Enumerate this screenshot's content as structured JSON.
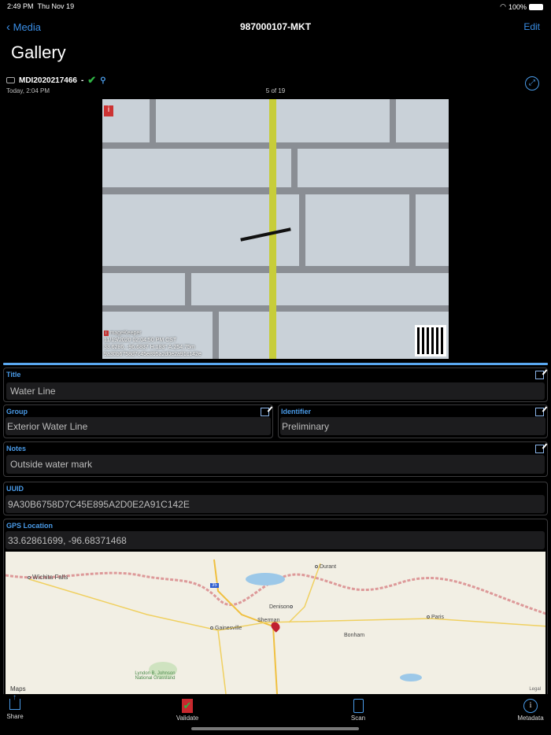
{
  "status": {
    "time": "2:49 PM",
    "date": "Thu Nov 19",
    "battery": "100%"
  },
  "nav": {
    "back": "Media",
    "title": "987000107-MKT",
    "edit": "Edit"
  },
  "page_title": "Gallery",
  "media": {
    "id": "MDI2020217466",
    "sep": "-",
    "timestamp": "Today, 2:04 PM",
    "counter": "5 of 19"
  },
  "photo": {
    "watermark_brand": "ImageKeeper",
    "overlay_lines": [
      "11/19/2020 02:04:50 PM CST",
      "33.6286, -96.6837 H:183° A:254.75m",
      "9a30b6758d7c45e895a2d0e2a91c142e"
    ]
  },
  "fields": {
    "title": {
      "label": "Title",
      "value": "Water Line"
    },
    "group": {
      "label": "Group",
      "value": "Exterior Water Line"
    },
    "identifier": {
      "label": "Identifier",
      "value": "Preliminary"
    },
    "notes": {
      "label": "Notes",
      "value": "Outside water mark"
    },
    "uuid": {
      "label": "UUID",
      "value": "9A30B6758D7C45E895A2D0E2A91C142E"
    },
    "gps": {
      "label": "GPS Location",
      "value": "33.62861699, -96.68371468"
    }
  },
  "map": {
    "labels": [
      "Wichita Falls",
      "Durant",
      "Denison",
      "Sherman",
      "Gainesville",
      "Bonham",
      "Paris",
      "Lyndon B. Johnson National Grassland"
    ],
    "highway": "35",
    "brand": "Maps",
    "legal": "Legal"
  },
  "toolbar": {
    "share": "Share",
    "validate": "Validate",
    "scan": "Scan",
    "metadata": "Metadata"
  },
  "colors": {
    "accent": "#3a8ee6",
    "check": "#2fb344"
  }
}
